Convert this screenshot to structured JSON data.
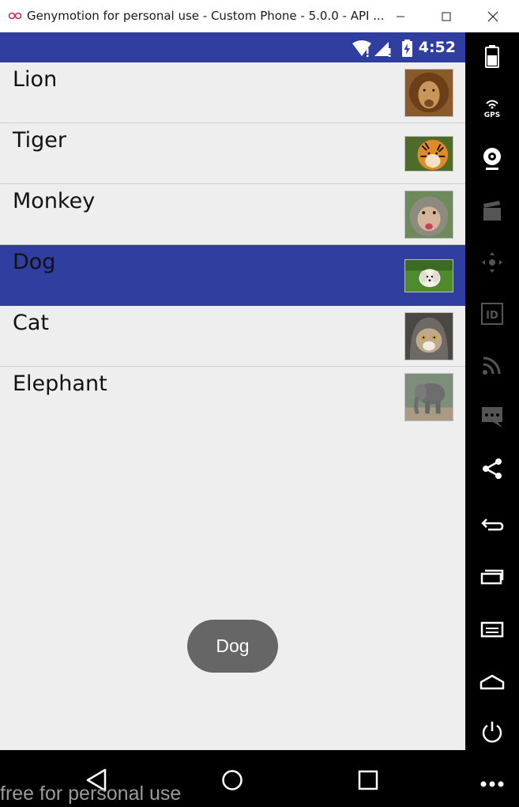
{
  "window": {
    "title": "Genymotion for personal use - Custom Phone - 5.0.0 - API ..."
  },
  "statusbar": {
    "time": "4:52"
  },
  "list": {
    "items": [
      {
        "label": "Lion"
      },
      {
        "label": "Tiger"
      },
      {
        "label": "Monkey"
      },
      {
        "label": "Dog",
        "selected": true
      },
      {
        "label": "Cat"
      },
      {
        "label": "Elephant"
      }
    ]
  },
  "toast": {
    "text": "Dog"
  },
  "watermark": {
    "text": "free for personal use"
  },
  "sidebar": {
    "gps_label": "GPS",
    "id_label": "ID",
    "icons": [
      "battery-icon",
      "gps-icon",
      "webcam-icon",
      "clapper-icon",
      "dpad-icon",
      "id-icon",
      "cast-icon",
      "message-icon",
      "share-icon",
      "back-icon",
      "recent-apps-icon",
      "menu-icon",
      "home-icon",
      "power-icon",
      "more-icon"
    ]
  },
  "colors": {
    "primary": "#303f9f",
    "background": "#eeeeee",
    "toast": "#666666"
  }
}
